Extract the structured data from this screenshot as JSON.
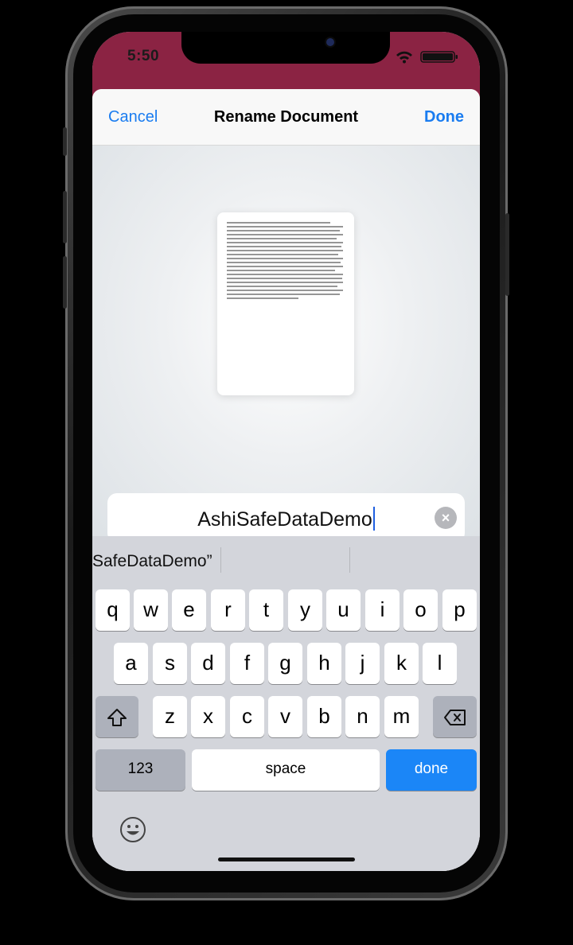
{
  "status_bar": {
    "time": "5:50"
  },
  "nav": {
    "cancel_label": "Cancel",
    "title": "Rename Document",
    "done_label": "Done"
  },
  "name_field": {
    "value": "AshiSafeDataDemo"
  },
  "keyboard": {
    "suggestion": "SafeDataDemo”",
    "row1": [
      "q",
      "w",
      "e",
      "r",
      "t",
      "y",
      "u",
      "i",
      "o",
      "p"
    ],
    "row2": [
      "a",
      "s",
      "d",
      "f",
      "g",
      "h",
      "j",
      "k",
      "l"
    ],
    "row3": [
      "z",
      "x",
      "c",
      "v",
      "b",
      "n",
      "m"
    ],
    "numbers_label": "123",
    "space_label": "space",
    "done_label": "done"
  },
  "colors": {
    "accent": "#1a7cf0",
    "status_bar": "#8b2343",
    "keyboard_done": "#1b86f7"
  }
}
